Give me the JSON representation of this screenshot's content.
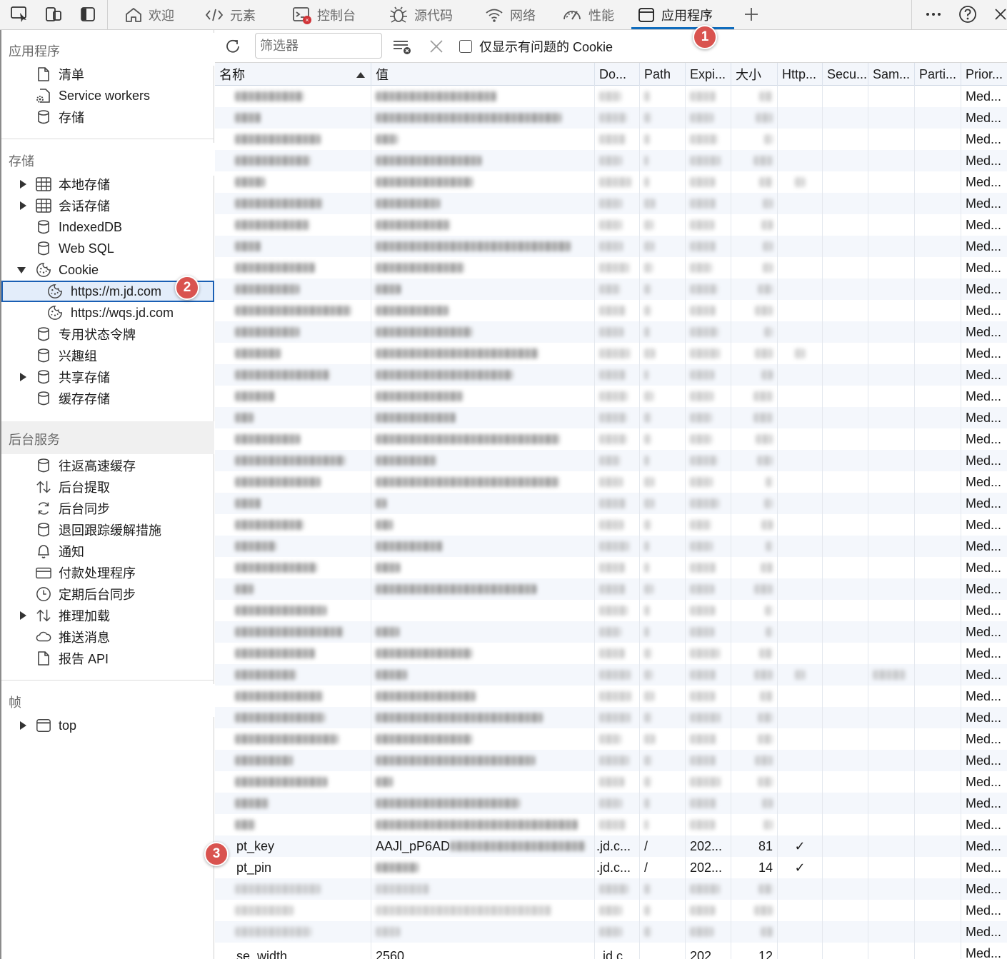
{
  "topbar": {
    "tabs": [
      {
        "label": "欢迎",
        "icon": "home-icon"
      },
      {
        "label": "元素",
        "icon": "code-icon"
      },
      {
        "label": "控制台",
        "icon": "console-icon"
      },
      {
        "label": "源代码",
        "icon": "sources-bug-icon"
      },
      {
        "label": "网络",
        "icon": "wifi-icon"
      },
      {
        "label": "性能",
        "icon": "performance-gauge-icon"
      },
      {
        "label": "应用程序",
        "icon": "application-window-icon"
      }
    ],
    "active_tab": "应用程序"
  },
  "badges": {
    "one": "1",
    "two": "2",
    "three": "3"
  },
  "sidebar": {
    "app_header": "应用程序",
    "app_items": [
      {
        "label": "清单",
        "icon": "file-icon"
      },
      {
        "label": "Service workers",
        "icon": "gear-file-icon"
      },
      {
        "label": "存储",
        "icon": "database-icon"
      }
    ],
    "storage_header": "存储",
    "storage_items": [
      {
        "label": "本地存储",
        "icon": "grid-icon",
        "expandable": true
      },
      {
        "label": "会话存储",
        "icon": "grid-icon",
        "expandable": true
      },
      {
        "label": "IndexedDB",
        "icon": "database-icon"
      },
      {
        "label": "Web SQL",
        "icon": "database-icon"
      },
      {
        "label": "Cookie",
        "icon": "cookie-icon",
        "expanded": true
      },
      {
        "label": "https://m.jd.com",
        "icon": "cookie-icon",
        "selected": true
      },
      {
        "label": "https://wqs.jd.com",
        "icon": "cookie-icon"
      },
      {
        "label": "专用状态令牌",
        "icon": "database-icon"
      },
      {
        "label": "兴趣组",
        "icon": "database-icon"
      },
      {
        "label": "共享存储",
        "icon": "database-icon",
        "expandable": true
      },
      {
        "label": "缓存存储",
        "icon": "database-icon"
      }
    ],
    "bg_header": "后台服务",
    "bg_items": [
      {
        "label": "往返高速缓存",
        "icon": "database-icon"
      },
      {
        "label": "后台提取",
        "icon": "up-down-arrows-icon"
      },
      {
        "label": "后台同步",
        "icon": "sync-icon"
      },
      {
        "label": "退回跟踪缓解措施",
        "icon": "database-icon"
      },
      {
        "label": "通知",
        "icon": "bell-icon"
      },
      {
        "label": "付款处理程序",
        "icon": "card-icon"
      },
      {
        "label": "定期后台同步",
        "icon": "clock-icon"
      },
      {
        "label": "推理加载",
        "icon": "up-down-arrows-icon",
        "expandable": true
      },
      {
        "label": "推送消息",
        "icon": "cloud-icon"
      },
      {
        "label": "报告 API",
        "icon": "file-icon"
      }
    ],
    "frames_header": "帧",
    "frames_items": [
      {
        "label": "top",
        "icon": "window-icon",
        "expandable": true
      }
    ]
  },
  "toolbar": {
    "filter_placeholder": "筛选器",
    "checkbox_label": "仅显示有问题的 Cookie"
  },
  "table": {
    "columns": [
      "名称",
      "值",
      "Do...",
      "Path",
      "Expi...",
      "大小",
      "Http...",
      "Secu...",
      "Sam...",
      "Parti...",
      "Prior..."
    ],
    "sorted_column": "名称",
    "priority_value": "Med...",
    "row_count": 41,
    "visible_rows": [
      {
        "row": 35,
        "name": "pt_key",
        "value": "AAJl_pP6AD",
        "domain": ".jd.c...",
        "path": "/",
        "expires": "202...",
        "size": "81",
        "http": "✓",
        "priority": "Med..."
      },
      {
        "row": 36,
        "name": "pt_pin",
        "value": "",
        "domain": ".jd.c...",
        "path": "/",
        "expires": "202...",
        "size": "14",
        "http": "✓",
        "priority": "Med..."
      }
    ],
    "partial_last_row": {
      "name": "se_width",
      "value": "2560",
      "domain": ".jd.c...",
      "expires": "202...",
      "size": "12",
      "priority": "Med..."
    }
  }
}
